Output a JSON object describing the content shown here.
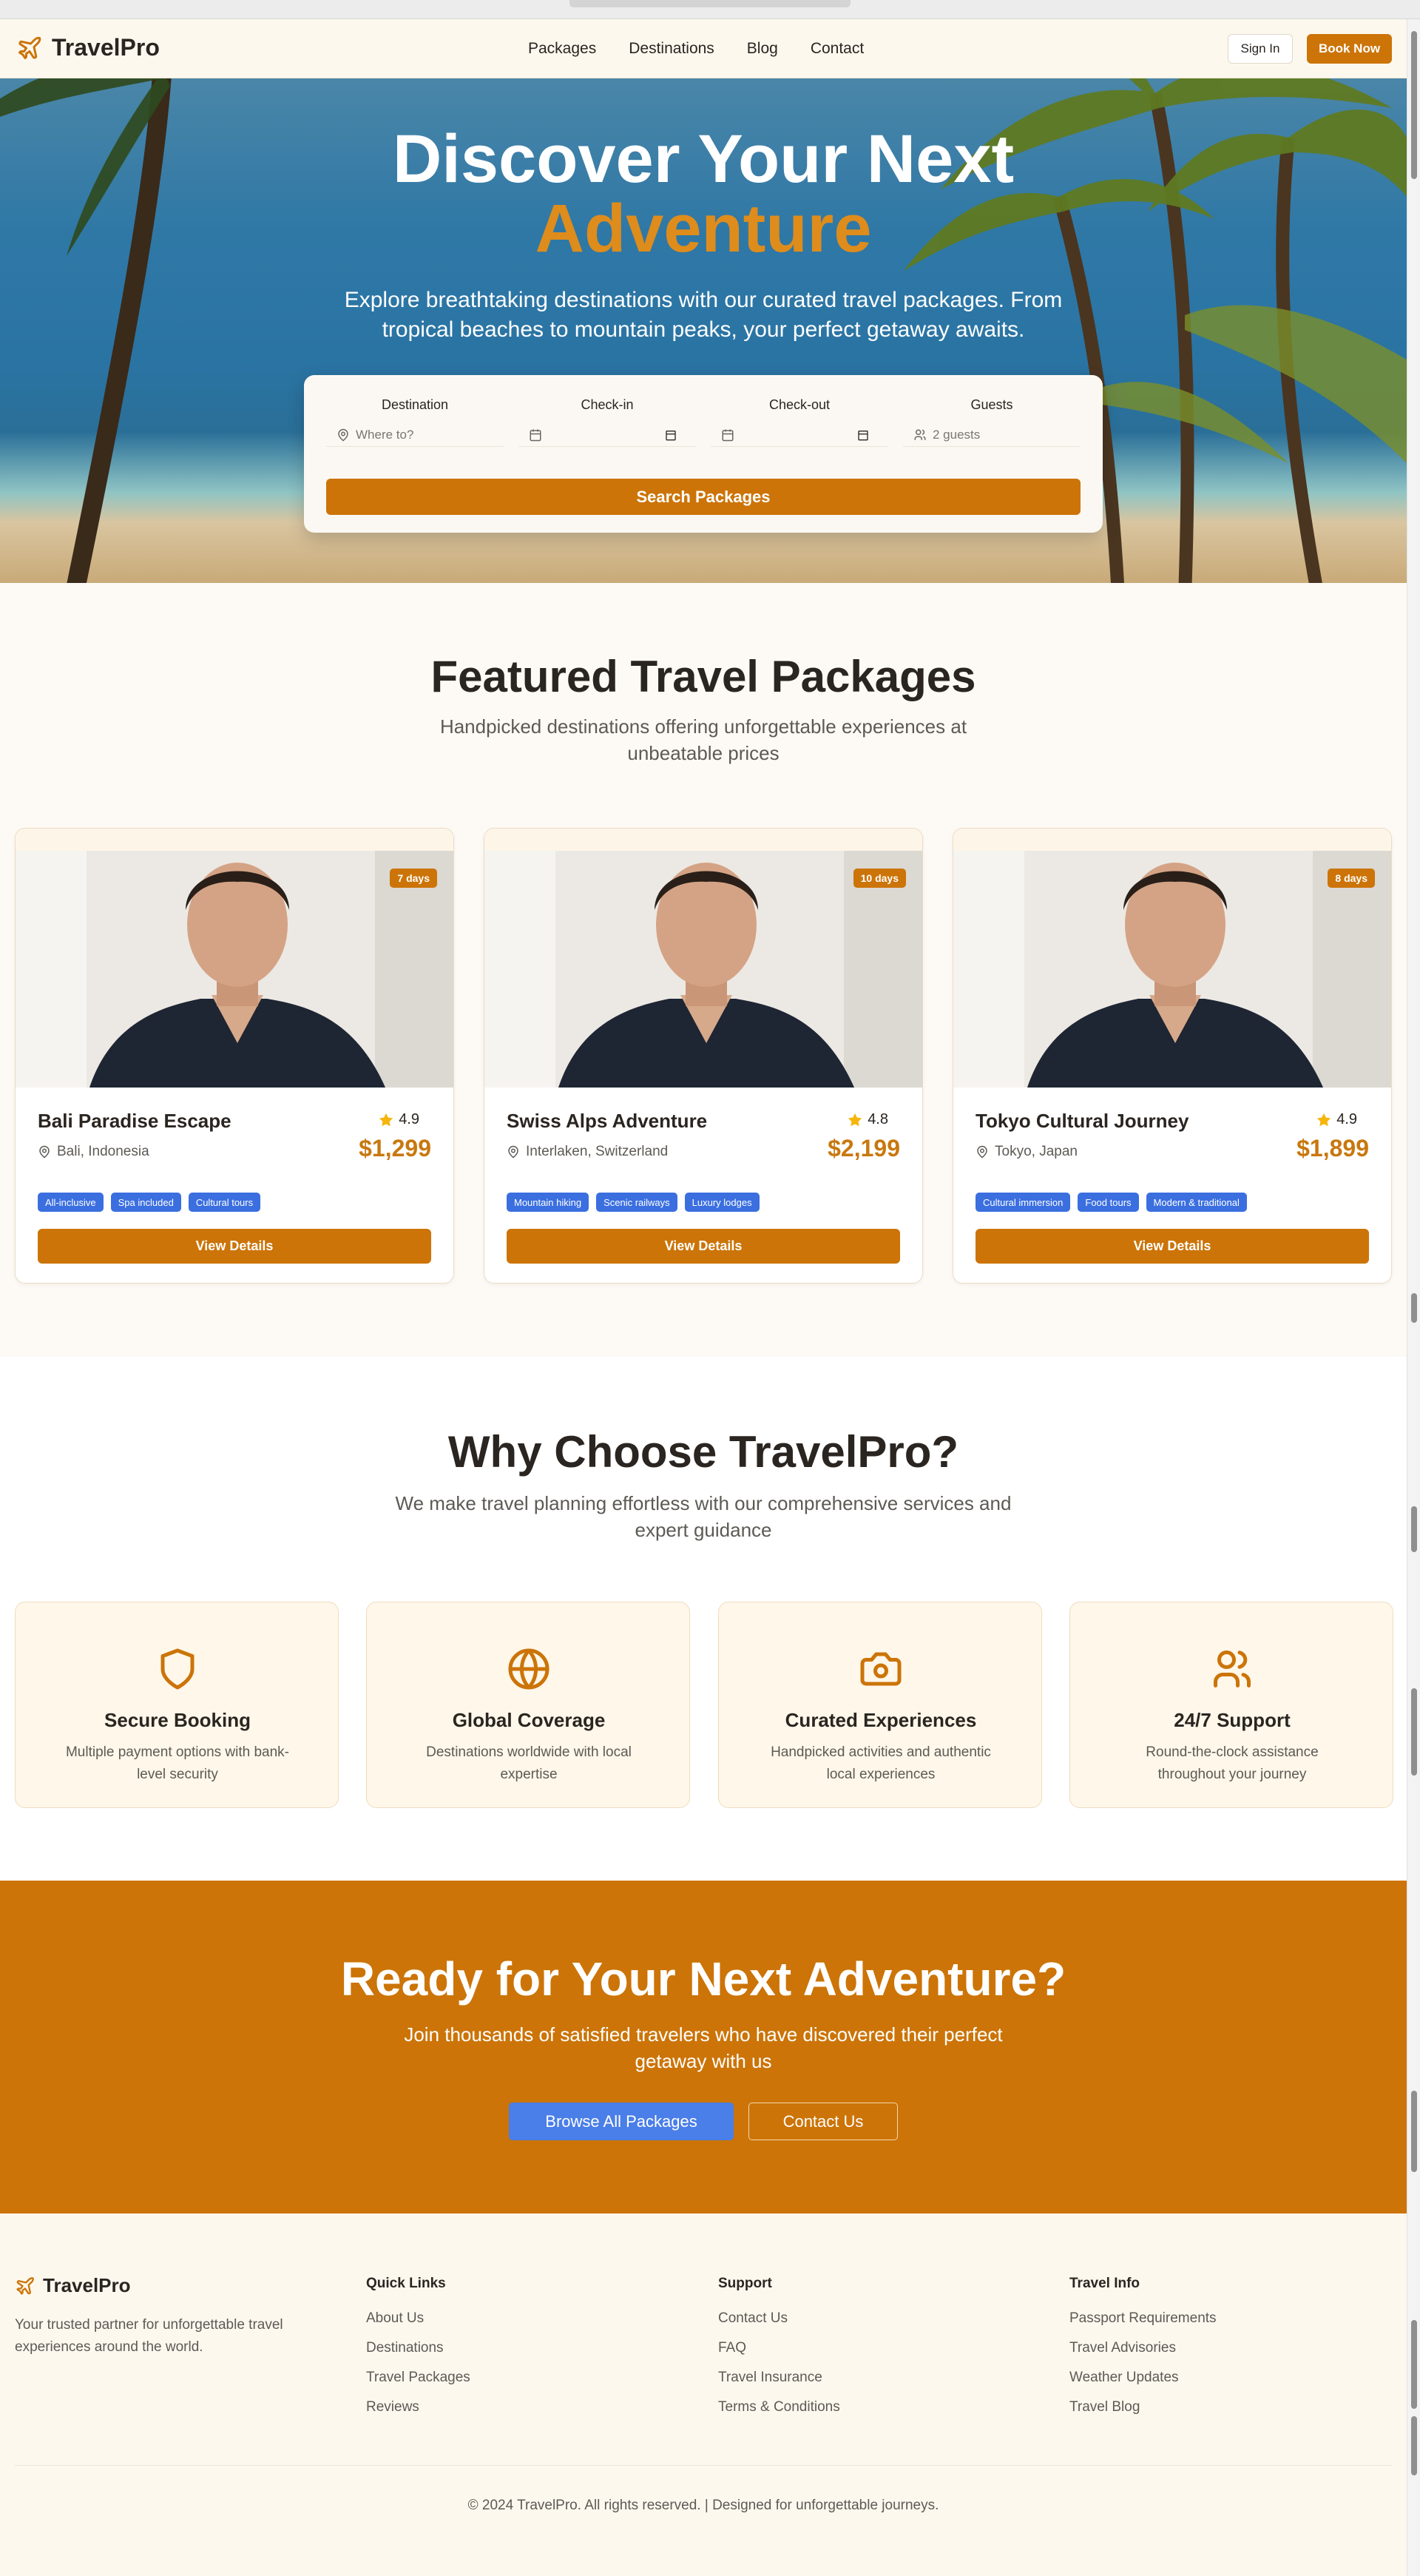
{
  "brand": {
    "name": "TravelPro",
    "accent": "#cc7408",
    "tag_blue": "#3b6fe0"
  },
  "nav": {
    "links": [
      "Packages",
      "Destinations",
      "Blog",
      "Contact"
    ],
    "sign_in": "Sign In",
    "book_now": "Book Now"
  },
  "hero": {
    "title_line1": "Discover Your Next",
    "title_line2": "Adventure",
    "subtitle": "Explore breathtaking destinations with our curated travel packages. From tropical beaches to mountain peaks, your perfect getaway awaits.",
    "search": {
      "destination_label": "Destination",
      "destination_placeholder": "Where to?",
      "checkin_label": "Check-in",
      "checkout_label": "Check-out",
      "guests_label": "Guests",
      "guests_value": "2 guests",
      "button": "Search Packages"
    }
  },
  "featured": {
    "title": "Featured Travel Packages",
    "subtitle": "Handpicked destinations offering unforgettable experiences at unbeatable prices",
    "cards": [
      {
        "days": "7 days",
        "title": "Bali Paradise Escape",
        "location": "Bali, Indonesia",
        "rating": "4.9",
        "price": "$1,299",
        "tags": [
          "All-inclusive",
          "Spa included",
          "Cultural tours"
        ],
        "button": "View Details"
      },
      {
        "days": "10 days",
        "title": "Swiss Alps Adventure",
        "location": "Interlaken, Switzerland",
        "rating": "4.8",
        "price": "$2,199",
        "tags": [
          "Mountain hiking",
          "Scenic railways",
          "Luxury lodges"
        ],
        "button": "View Details"
      },
      {
        "days": "8 days",
        "title": "Tokyo Cultural Journey",
        "location": "Tokyo, Japan",
        "rating": "4.9",
        "price": "$1,899",
        "tags": [
          "Cultural immersion",
          "Food tours",
          "Modern & traditional"
        ],
        "button": "View Details"
      }
    ]
  },
  "why": {
    "title": "Why Choose TravelPro?",
    "subtitle": "We make travel planning effortless with our comprehensive services and expert guidance",
    "features": [
      {
        "icon": "shield-icon",
        "title": "Secure Booking",
        "desc": "Multiple payment options with bank-level security"
      },
      {
        "icon": "globe-icon",
        "title": "Global Coverage",
        "desc": "Destinations worldwide with local expertise"
      },
      {
        "icon": "camera-icon",
        "title": "Curated Experiences",
        "desc": "Handpicked activities and authentic local experiences"
      },
      {
        "icon": "users-icon",
        "title": "24/7 Support",
        "desc": "Round-the-clock assistance throughout your journey"
      }
    ]
  },
  "cta": {
    "title": "Ready for Your Next Adventure?",
    "subtitle": "Join thousands of satisfied travelers who have discovered their perfect getaway with us",
    "primary": "Browse All Packages",
    "secondary": "Contact Us"
  },
  "footer": {
    "brand": "TravelPro",
    "desc": "Your trusted partner for unforgettable travel experiences around the world.",
    "columns": [
      {
        "title": "Quick Links",
        "links": [
          "About Us",
          "Destinations",
          "Travel Packages",
          "Reviews"
        ]
      },
      {
        "title": "Support",
        "links": [
          "Contact Us",
          "FAQ",
          "Travel Insurance",
          "Terms & Conditions"
        ]
      },
      {
        "title": "Travel Info",
        "links": [
          "Passport Requirements",
          "Travel Advisories",
          "Weather Updates",
          "Travel Blog"
        ]
      }
    ],
    "copyright": "© 2024 TravelPro. All rights reserved. | Designed for unforgettable journeys."
  }
}
